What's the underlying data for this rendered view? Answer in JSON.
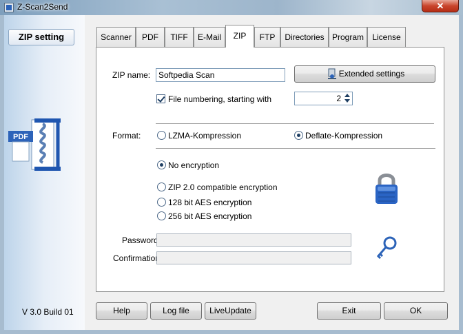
{
  "window": {
    "title": "Z-Scan2Send",
    "close_glyph": "✕"
  },
  "sidebar": {
    "section_label": "ZIP setting",
    "version": "V 3.0 Build 01"
  },
  "tabs": [
    {
      "label": "Scanner"
    },
    {
      "label": "PDF"
    },
    {
      "label": "TIFF"
    },
    {
      "label": "E-Mail"
    },
    {
      "label": "ZIP"
    },
    {
      "label": "FTP"
    },
    {
      "label": "Directories"
    },
    {
      "label": "Program"
    },
    {
      "label": "License"
    }
  ],
  "active_tab": "ZIP",
  "zip": {
    "name_label": "ZIP name:",
    "name_value": "Softpedia Scan",
    "extended_button": "Extended settings",
    "file_numbering_label": "File numbering, starting with",
    "file_numbering_checked": true,
    "start_value": "2",
    "format_label": "Format:",
    "format_options": [
      {
        "label": "LZMA-Kompression",
        "selected": false
      },
      {
        "label": "Deflate-Kompression",
        "selected": true
      }
    ],
    "encryption_options": [
      {
        "label": "No encryption",
        "selected": true
      },
      {
        "label": "ZIP 2.0 compatible encryption",
        "selected": false
      },
      {
        "label": "128 bit AES encryption",
        "selected": false
      },
      {
        "label": "256 bit AES encryption",
        "selected": false
      }
    ],
    "password_label": "Password:",
    "password_value": "",
    "confirmation_label": "Confirmation:",
    "confirmation_value": ""
  },
  "footer": {
    "help": "Help",
    "logfile": "Log file",
    "liveupdate": "LiveUpdate",
    "exit": "Exit",
    "ok": "OK"
  },
  "icons": {
    "pdf_badge": "PDF",
    "lock": "lock-icon",
    "key": "key-icon",
    "settings": "settings-icon"
  },
  "colors": {
    "accent": "#2c63b8",
    "lock_body": "#2a64c4",
    "lock_shackle": "#8a8f96"
  }
}
